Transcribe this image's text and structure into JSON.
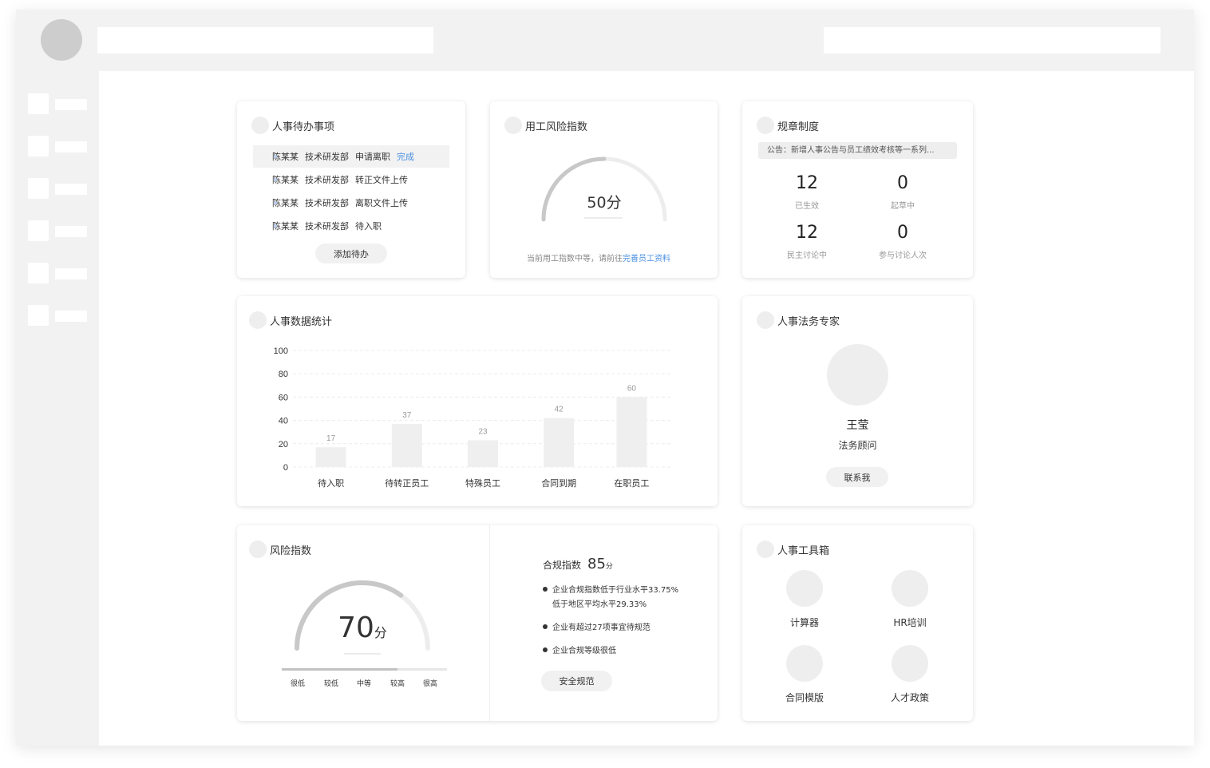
{
  "todo": {
    "title": "人事待办事项",
    "items": [
      {
        "name": "陈某某",
        "dept": "技术研发部",
        "action": "申请离职",
        "done": "完成"
      },
      {
        "name": "陈某某",
        "dept": "技术研发部",
        "action": "转正文件上传",
        "done": ""
      },
      {
        "name": "陈某某",
        "dept": "技术研发部",
        "action": "离职文件上传",
        "done": ""
      },
      {
        "name": "陈某某",
        "dept": "技术研发部",
        "action": "待入职",
        "done": ""
      }
    ],
    "add_button": "添加待办"
  },
  "employment_risk": {
    "title": "用工风险指数",
    "score": "50",
    "unit": "分",
    "level": 0.5,
    "note_prefix": "当前用工指数中等，请前往",
    "note_link": "完善员工资料"
  },
  "rules": {
    "title": "规章制度",
    "announcement": "公告：新增人事公告与员工绩效考核等一系列...",
    "stats": [
      {
        "value": "12",
        "label": "已生效"
      },
      {
        "value": "0",
        "label": "起草中"
      },
      {
        "value": "12",
        "label": "民主讨论中"
      },
      {
        "value": "0",
        "label": "参与讨论人次"
      }
    ]
  },
  "hr_stats": {
    "title": "人事数据统计"
  },
  "chart_data": {
    "type": "bar",
    "categories": [
      "待入职",
      "待转正员工",
      "特殊员工",
      "合同到期",
      "在职员工"
    ],
    "values": [
      17,
      37,
      23,
      42,
      60
    ],
    "yticks": [
      0,
      20,
      40,
      60,
      80,
      100
    ],
    "ylim": [
      0,
      100
    ],
    "grid": true,
    "bar_color": "#efefef"
  },
  "legal": {
    "title": "人事法务专家",
    "name": "王莹",
    "role": "法务顾问",
    "contact_button": "联系我"
  },
  "risk_index": {
    "title": "风险指数",
    "score": "70",
    "unit": "分",
    "level": 0.7,
    "scale": [
      "很低",
      "较低",
      "中等",
      "较高",
      "很高"
    ],
    "compliance_label": "合规指数",
    "compliance_score": "85",
    "compliance_unit": "分",
    "items": [
      {
        "line1": "企业合规指数低于行业水平33.75%",
        "line2": "低于地区平均水平29.33%"
      },
      {
        "line1": "企业有超过27项事宜待规范",
        "line2": ""
      },
      {
        "line1": "企业合规等级很低",
        "line2": ""
      }
    ],
    "safety_button": "安全规范"
  },
  "toolbox": {
    "title": "人事工具箱",
    "tools": [
      "计算器",
      "HR培训",
      "合同模版",
      "人才政策"
    ]
  }
}
